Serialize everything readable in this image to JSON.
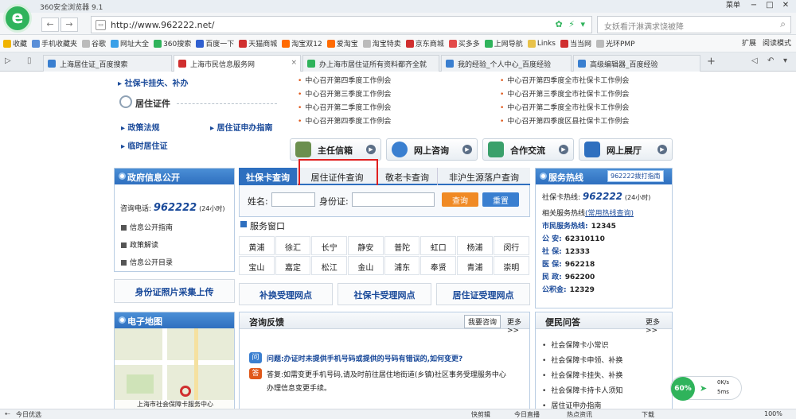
{
  "browser": {
    "title": "360安全浏览器 9.1",
    "menu_label": "菜单",
    "url": "http://www.962222.net/",
    "search_placeholder": "女妖看汗淋满求饶被降",
    "logo_glyph": "e"
  },
  "favorites": [
    {
      "label": "收藏",
      "color": "#f0b400"
    },
    {
      "label": "手机收藏夹",
      "color": "#5a8fd8"
    },
    {
      "label": "谷歌",
      "color": "#bbbbbb"
    },
    {
      "label": "网址大全",
      "color": "#3aa0e8"
    },
    {
      "label": "360搜索",
      "color": "#2fb35b"
    },
    {
      "label": "百度一下",
      "color": "#2f5fd0"
    },
    {
      "label": "天猫商城",
      "color": "#d02f2f"
    },
    {
      "label": "淘宝双12",
      "color": "#ff6a00"
    },
    {
      "label": "爱淘宝",
      "color": "#ff6a00"
    },
    {
      "label": "淘宝特卖",
      "color": "#bbbbbb"
    },
    {
      "label": "京东商城",
      "color": "#d02f2f"
    },
    {
      "label": "买多多",
      "color": "#e34a4a"
    },
    {
      "label": "上网导航",
      "color": "#2fb35b"
    },
    {
      "label": "Links",
      "color": "#e8c24a"
    },
    {
      "label": "当当网",
      "color": "#d02f2f"
    },
    {
      "label": "光环PMP",
      "color": "#bbbbbb"
    }
  ],
  "favorites_right": [
    "扩展",
    "阅读模式"
  ],
  "tabs": [
    {
      "label": "上海居住证_百度搜索"
    },
    {
      "label": "上海市民信息服务网"
    },
    {
      "label": "办上海市居住证所有资料都齐全就"
    },
    {
      "label": "我的经验_个人中心_百度经验"
    },
    {
      "label": "高级编辑器_百度经验"
    }
  ],
  "left": {
    "top_links": [
      "社保卡挂失、补办"
    ],
    "section_title": "居住证件",
    "links": [
      "政策法规",
      "居住证申办指南",
      "临时居住证"
    ],
    "gov_panel": {
      "title": "政府信息公开",
      "phone_label": "咨询电话:",
      "phone": "962222",
      "phone_note": "(24小时)",
      "items": [
        "信息公开指南",
        "政策解读",
        "信息公开目录"
      ]
    },
    "upload_button": "身份证照片采集上传",
    "map_panel": {
      "title": "电子地图",
      "caption": "上海市社会保障卡服务中心"
    }
  },
  "news_left": [
    "中心召开第四季度工作例会",
    "中心召开第三季度工作例会",
    "中心召开第二季度工作例会",
    "中心召开第四季度工作例会"
  ],
  "news_right": [
    "中心召开第四季度全市社保卡工作例会",
    "中心召开第三季度全市社保卡工作例会",
    "中心召开第二季度全市社保卡工作例会",
    "中心召开第四季度区县社保卡工作例会"
  ],
  "service_buttons": [
    {
      "label": "主任信箱",
      "color": "#6b8f4e"
    },
    {
      "label": "网上咨询",
      "color": "#3a7fd0"
    },
    {
      "label": "合作交流",
      "color": "#3aa06b"
    },
    {
      "label": "网上展厅",
      "color": "#2e6fbf"
    }
  ],
  "query": {
    "tabs": [
      "社保卡查询",
      "居住证件查询",
      "敬老卡查询",
      "非沪生源落户查询"
    ],
    "name_label": "姓名:",
    "id_label": "身份证:",
    "query_button": "查询",
    "reset_button": "重置"
  },
  "window": {
    "title": "服务窗口",
    "districts": [
      "黄浦",
      "徐汇",
      "长宁",
      "静安",
      "普陀",
      "虹口",
      "杨浦",
      "闵行",
      "宝山",
      "嘉定",
      "松江",
      "金山",
      "浦东",
      "奉贤",
      "青浦",
      "崇明"
    ]
  },
  "network_buttons": [
    "补换受理网点",
    "社保卡受理网点",
    "居住证受理网点"
  ],
  "consult": {
    "title": "咨询反馈",
    "ask_button": "我要咨询",
    "more": "更多>>",
    "q_label": "问题:",
    "question": "办证时未提供手机号码或提供的号码有错误的,如何变更?",
    "a_label": "答复:",
    "answer_line1": "如需变更手机号码,请及时前往居住地街道(乡镇)社区事务受理服务中心",
    "answer_line2": "办理信息变更手续。"
  },
  "hotline": {
    "title": "服务热线",
    "dial_button": "962222拨打指南",
    "sb_label": "社保卡热线:",
    "sb_number": "962222",
    "sb_note": "(24小时)",
    "link_prefix": "相关服务热线",
    "link_text": "(常用热线查询)",
    "lines": [
      {
        "k": "市民服务热线:",
        "v": "12345"
      },
      {
        "k": "公  安:",
        "v": "62310110"
      },
      {
        "k": "社  保:",
        "v": "12333"
      },
      {
        "k": "医  保:",
        "v": "962218"
      },
      {
        "k": "民  政:",
        "v": "962200"
      },
      {
        "k": "公积金:",
        "v": "12329"
      }
    ]
  },
  "faq": {
    "title": "便民问答",
    "more": "更多>>",
    "items": [
      "社会保障卡小常识",
      "社会保障卡申领、补换",
      "社会保障卡挂失、补换",
      "社会保障卡持卡人须知",
      "居住证申办指南"
    ]
  },
  "float_widget": {
    "percent": "60%",
    "rate": "0K/s",
    "ping": "5ms"
  },
  "status": {
    "left": "今日优选",
    "items": [
      "快剪辑",
      "今日直播",
      "热点资讯",
      "下载"
    ],
    "zoom": "100%"
  }
}
